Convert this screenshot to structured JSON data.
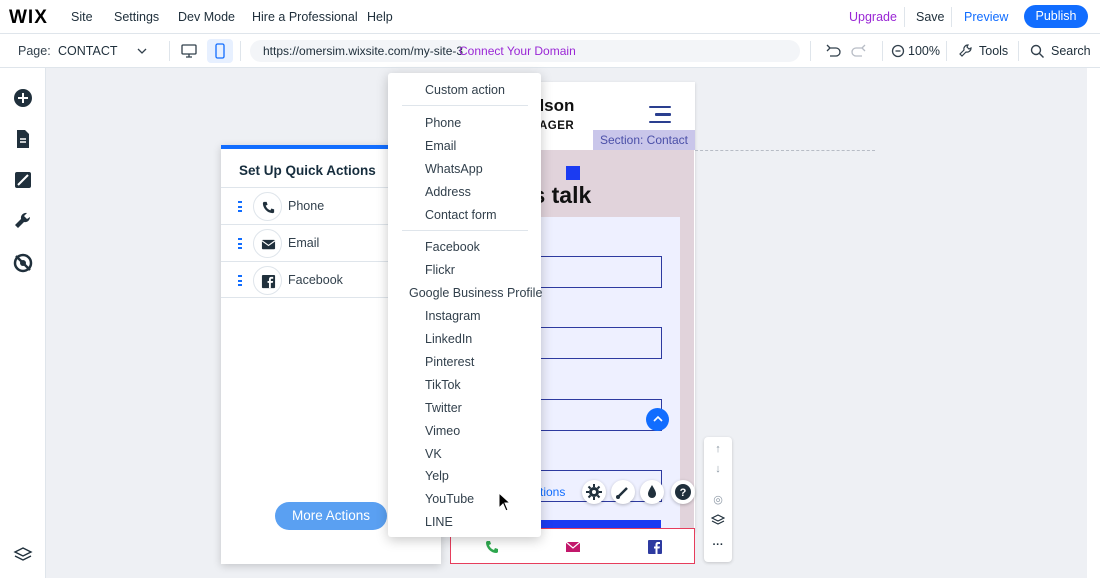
{
  "topbar": {
    "logo": "WIX",
    "menu": [
      "Site",
      "Settings",
      "Dev Mode",
      "Hire a Professional",
      "Help"
    ],
    "upgrade": "Upgrade",
    "save": "Save",
    "preview": "Preview",
    "publish": "Publish"
  },
  "bar2": {
    "page_label": "Page:",
    "page_value": "CONTACT",
    "url": "https://omersim.wixsite.com/my-site-3",
    "connect_domain": "Connect Your Domain",
    "zoom": "100%",
    "tools": "Tools",
    "search": "Search"
  },
  "site": {
    "name": "elson",
    "role": "AGER",
    "section_tag": "Section: Contact",
    "headline": "'s talk",
    "floating_label": "tions"
  },
  "panel": {
    "title": "Set Up Quick Actions",
    "rows": [
      {
        "label": "Phone",
        "icon": "phone-icon"
      },
      {
        "label": "Email",
        "icon": "email-icon"
      },
      {
        "label": "Facebook",
        "icon": "facebook-icon"
      }
    ],
    "more_actions": "More Actions"
  },
  "dropdown": {
    "custom": "Custom action",
    "contact": [
      "Phone",
      "Email",
      "WhatsApp",
      "Address",
      "Contact form"
    ],
    "social": [
      "Facebook",
      "Flickr",
      "Google Business Profile",
      "Instagram",
      "LinkedIn",
      "Pinterest",
      "TikTok",
      "Twitter",
      "Vimeo",
      "VK",
      "Yelp",
      "YouTube",
      "LINE"
    ]
  },
  "colors": {
    "accent": "#116dff",
    "upgrade": "#9a27d5",
    "phone": "#2fa84f",
    "email": "#c2186b",
    "facebook": "#1b3bf2"
  }
}
